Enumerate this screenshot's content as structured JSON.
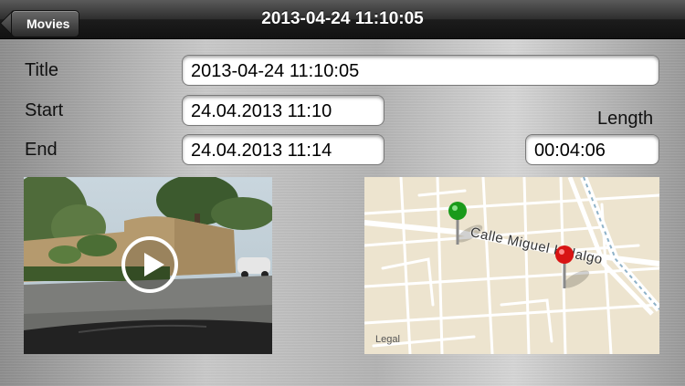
{
  "nav": {
    "back_label": "Movies",
    "title": "2013-04-24 11:10:05"
  },
  "form": {
    "title_label": "Title",
    "title_value": "2013-04-24 11:10:05",
    "start_label": "Start",
    "start_value": "24.04.2013 11:10",
    "end_label": "End",
    "end_value": "24.04.2013 11:14",
    "length_label": "Length",
    "length_value": "00:04:06"
  },
  "map": {
    "street_label": "Calle Miguel Hidalgo",
    "legal_label": "Legal",
    "start_pin_color": "#1a9a1a",
    "end_pin_color": "#d81414"
  },
  "video": {
    "play_icon": "play-icon"
  }
}
